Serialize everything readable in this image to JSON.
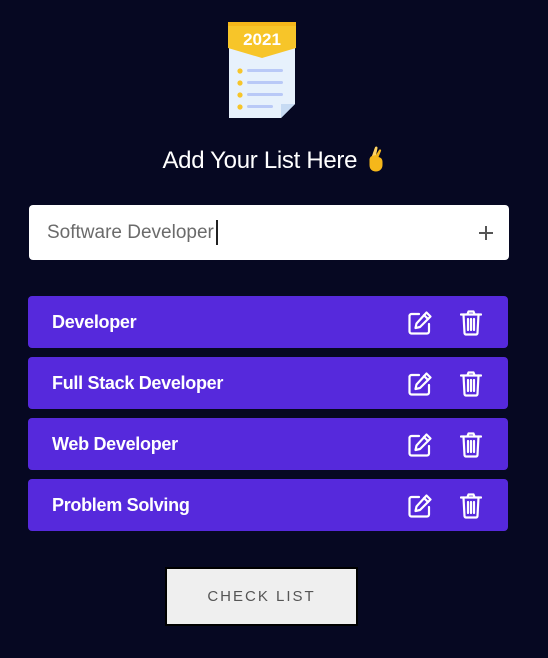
{
  "logo": {
    "year": "2021",
    "icon": "checklist-icon"
  },
  "heading": {
    "text": "Add Your List Here",
    "emoji": "crossed-fingers-icon"
  },
  "input": {
    "value": "Software Developer",
    "add_icon": "plus-icon"
  },
  "items": [
    {
      "label": "Developer"
    },
    {
      "label": "Full Stack Developer"
    },
    {
      "label": "Web Developer"
    },
    {
      "label": "Problem Solving"
    }
  ],
  "item_icons": {
    "edit": "edit-icon",
    "delete": "trash-icon"
  },
  "check_button": {
    "label": "CHECK LIST"
  },
  "colors": {
    "background": "#060822",
    "item": "#5629dc",
    "logo_banner": "#f7c529",
    "logo_paper": "#e7f1fc"
  }
}
